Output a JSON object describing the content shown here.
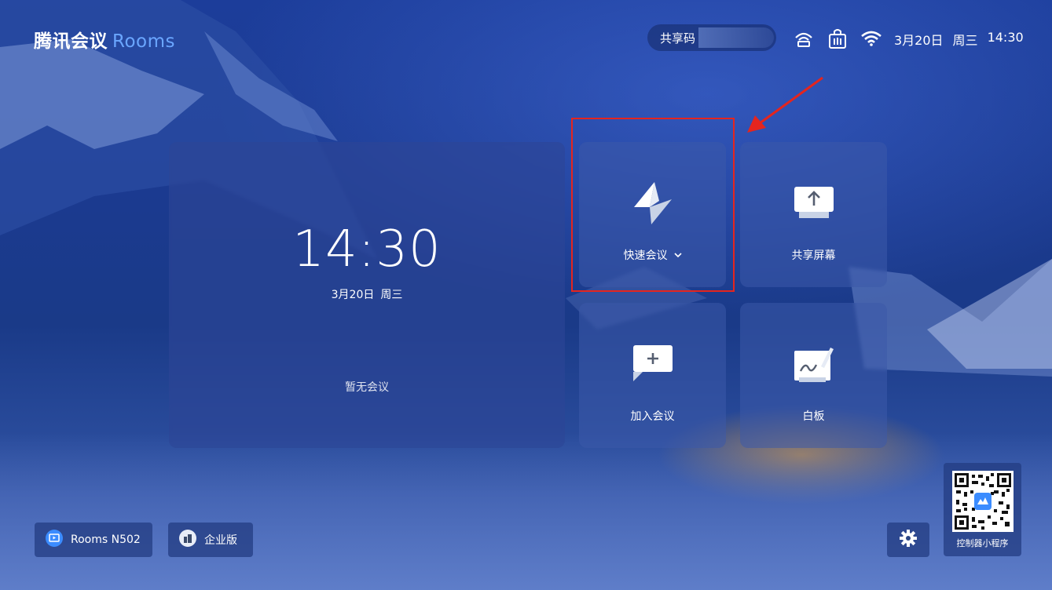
{
  "header": {
    "brand": "腾讯会议",
    "product": "Rooms",
    "share_code_label": "共享码",
    "date": "3月20日",
    "weekday": "周三",
    "time": "14:30",
    "status_icons": [
      "projection-icon",
      "network-lock-icon",
      "wifi-icon"
    ]
  },
  "main_tile": {
    "clock": "14:30",
    "date": "3月20日",
    "weekday": "周三",
    "empty_text": "暂无会议"
  },
  "actions": {
    "quick_meeting": "快速会议",
    "share_screen": "共享屏幕",
    "join_meeting": "加入会议",
    "whiteboard": "白板"
  },
  "footer": {
    "room_name": "Rooms N502",
    "edition": "企业版",
    "mini_program": "控制器小程序"
  },
  "colors": {
    "accent": "#6aa6ff",
    "highlight": "#e5251e"
  }
}
